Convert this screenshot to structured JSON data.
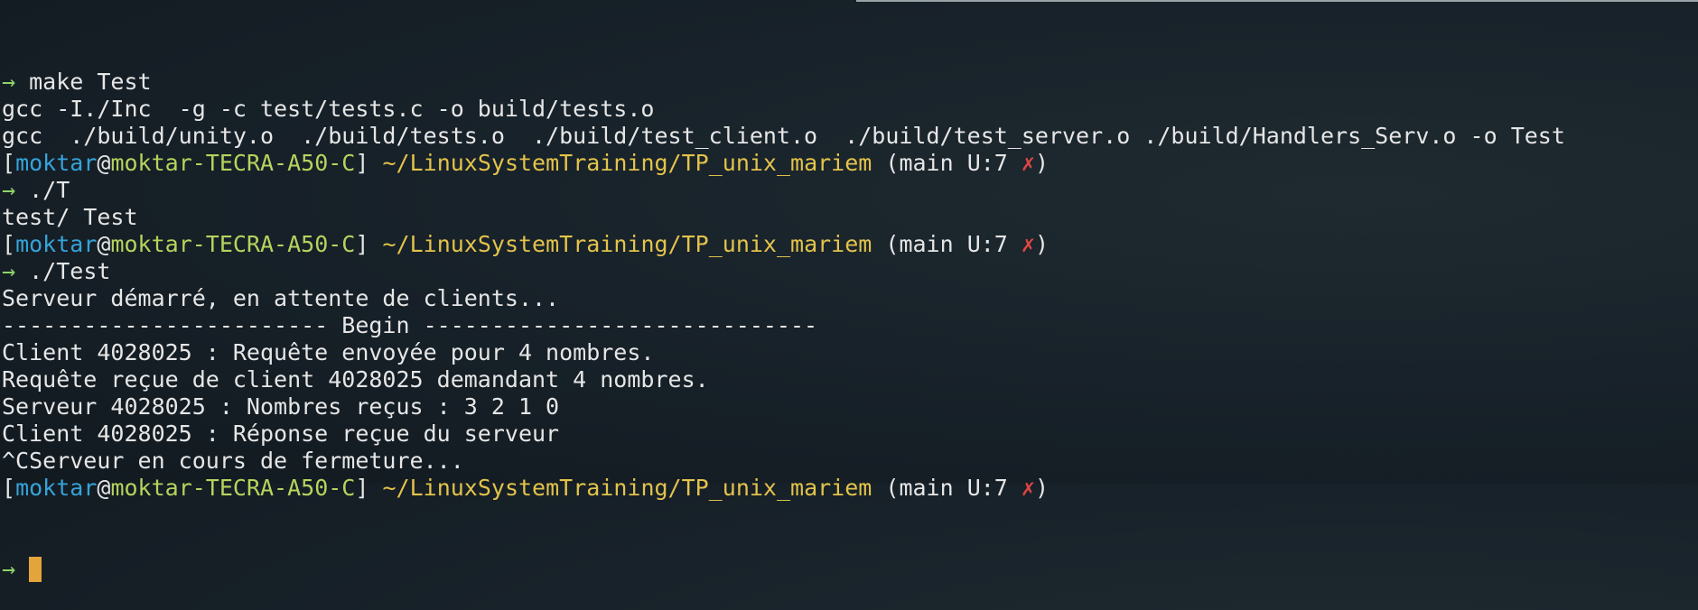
{
  "terminal": {
    "lines": [
      [
        {
          "t": "→ ",
          "c": "arrow"
        },
        {
          "t": "make Test",
          "c": "plain"
        }
      ],
      [
        {
          "t": "gcc -I./Inc  -g -c test/tests.c -o build/tests.o",
          "c": "plain"
        }
      ],
      [
        {
          "t": "gcc  ./build/unity.o  ./build/tests.o  ./build/test_client.o  ./build/test_server.o ./build/Handlers_Serv.o -o Test",
          "c": "plain"
        }
      ],
      [
        {
          "t": "[",
          "c": "plain"
        },
        {
          "t": "moktar",
          "c": "user"
        },
        {
          "t": "@",
          "c": "plain"
        },
        {
          "t": "moktar-TECRA-A50-C",
          "c": "host"
        },
        {
          "t": "] ",
          "c": "plain"
        },
        {
          "t": "~/LinuxSystemTraining/TP_unix_mariem",
          "c": "path"
        },
        {
          "t": " (main U:7 ",
          "c": "plain"
        },
        {
          "t": "✗",
          "c": "x"
        },
        {
          "t": ")",
          "c": "plain"
        }
      ],
      [
        {
          "t": "→ ",
          "c": "arrow"
        },
        {
          "t": "./T",
          "c": "plain"
        }
      ],
      [
        {
          "t": "test/ Test",
          "c": "plain"
        }
      ],
      [
        {
          "t": "[",
          "c": "plain"
        },
        {
          "t": "moktar",
          "c": "user"
        },
        {
          "t": "@",
          "c": "plain"
        },
        {
          "t": "moktar-TECRA-A50-C",
          "c": "host"
        },
        {
          "t": "] ",
          "c": "plain"
        },
        {
          "t": "~/LinuxSystemTraining/TP_unix_mariem",
          "c": "path"
        },
        {
          "t": " (main U:7 ",
          "c": "plain"
        },
        {
          "t": "✗",
          "c": "x"
        },
        {
          "t": ")",
          "c": "plain"
        }
      ],
      [
        {
          "t": "→ ",
          "c": "arrow"
        },
        {
          "t": "./Test",
          "c": "plain"
        }
      ],
      [
        {
          "t": "Serveur démarré, en attente de clients...",
          "c": "plain"
        }
      ],
      [
        {
          "t": "------------------------ Begin -----------------------------",
          "c": "plain"
        }
      ],
      [
        {
          "t": "Client 4028025 : Requête envoyée pour 4 nombres.",
          "c": "plain"
        }
      ],
      [
        {
          "t": "Requête reçue de client 4028025 demandant 4 nombres.",
          "c": "plain"
        }
      ],
      [
        {
          "t": "Serveur 4028025 : Nombres reçus : 3 2 1 0",
          "c": "plain"
        }
      ],
      [
        {
          "t": "Client 4028025 : Réponse reçue du serveur",
          "c": "plain"
        }
      ],
      [
        {
          "t": "^CServeur en cours de fermeture...",
          "c": "plain"
        }
      ],
      [
        {
          "t": "[",
          "c": "plain"
        },
        {
          "t": "moktar",
          "c": "user"
        },
        {
          "t": "@",
          "c": "plain"
        },
        {
          "t": "moktar-TECRA-A50-C",
          "c": "host"
        },
        {
          "t": "] ",
          "c": "plain"
        },
        {
          "t": "~/LinuxSystemTraining/TP_unix_mariem",
          "c": "path"
        },
        {
          "t": " (main U:7 ",
          "c": "plain"
        },
        {
          "t": "✗",
          "c": "x"
        },
        {
          "t": ")",
          "c": "plain"
        }
      ]
    ],
    "prompt_arrow": "→",
    "colors": {
      "arrow": "#8fd36a",
      "user": "#36a3d9",
      "host": "#b6d35d",
      "path": "#e3c34a",
      "x": "#e04545",
      "plain": "#e6e6e6",
      "cursor": "#e2a43b",
      "background": "#18222a"
    }
  }
}
